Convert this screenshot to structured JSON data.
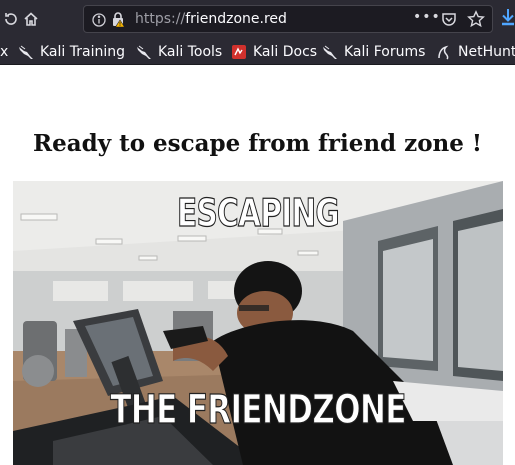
{
  "browser": {
    "url_protocol": "https://",
    "url_host": "friendzone.red",
    "menu_dots": "•••"
  },
  "bookmarks": [
    {
      "label": "x",
      "icon": "tab-fragment"
    },
    {
      "label": "Kali Training",
      "icon": "kali-dragon-icon"
    },
    {
      "label": "Kali Tools",
      "icon": "kali-dragon-icon"
    },
    {
      "label": "Kali Docs",
      "icon": "kali-docs-icon"
    },
    {
      "label": "Kali Forums",
      "icon": "kali-dragon-icon"
    },
    {
      "label": "NetHunter",
      "icon": "nethunter-icon"
    }
  ],
  "page": {
    "heading": "Ready to escape from friend zone !",
    "gif": {
      "top_caption": "ESCAPING",
      "bottom_caption": "THE FRIENDZONE"
    }
  },
  "colors": {
    "toolbar": "#2b2a33",
    "urlbar": "#1c1b22",
    "download_accent": "#4fa6ff",
    "lock_warning": "#f5b400",
    "kali_docs_red": "#d0312d"
  }
}
